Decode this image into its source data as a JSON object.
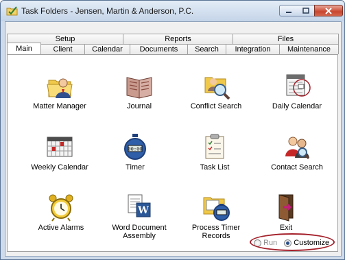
{
  "window": {
    "title": "Task Folders - Jensen, Martin & Anderson, P.C.",
    "icon": "folder-check-icon"
  },
  "window_controls": {
    "minimize": "minimize-icon",
    "maximize": "maximize-icon",
    "close": "close-icon"
  },
  "tabs_back": [
    {
      "label": "Setup"
    },
    {
      "label": "Reports"
    },
    {
      "label": "Files"
    }
  ],
  "tabs_front": [
    {
      "label": "Main",
      "active": true
    },
    {
      "label": "Client"
    },
    {
      "label": "Calendar"
    },
    {
      "label": "Documents"
    },
    {
      "label": "Search"
    },
    {
      "label": "Integration"
    },
    {
      "label": "Maintenance"
    }
  ],
  "items": [
    {
      "label": "Matter Manager",
      "icon": "matter-manager-icon"
    },
    {
      "label": "Journal",
      "icon": "journal-book-icon"
    },
    {
      "label": "Conflict Search",
      "icon": "conflict-search-icon"
    },
    {
      "label": "Daily Calendar",
      "icon": "daily-calendar-icon"
    },
    {
      "label": "Weekly Calendar",
      "icon": "weekly-calendar-icon"
    },
    {
      "label": "Timer",
      "icon": "timer-stopwatch-icon"
    },
    {
      "label": "Task List",
      "icon": "task-list-icon"
    },
    {
      "label": "Contact Search",
      "icon": "contact-search-icon"
    },
    {
      "label": "Active Alarms",
      "icon": "alarm-clock-icon"
    },
    {
      "label": "Word Document Assembly",
      "icon": "word-document-icon"
    },
    {
      "label": "Process Timer Records",
      "icon": "process-timer-icon"
    },
    {
      "label": "Exit",
      "icon": "exit-door-icon"
    }
  ],
  "options": {
    "run_label": "Run",
    "customize_label": "Customize",
    "selected": "Customize"
  },
  "colors": {
    "highlight_red": "#a4202a",
    "title_gradient_top": "#e4edf7",
    "close_button_red": "#c8452e"
  }
}
